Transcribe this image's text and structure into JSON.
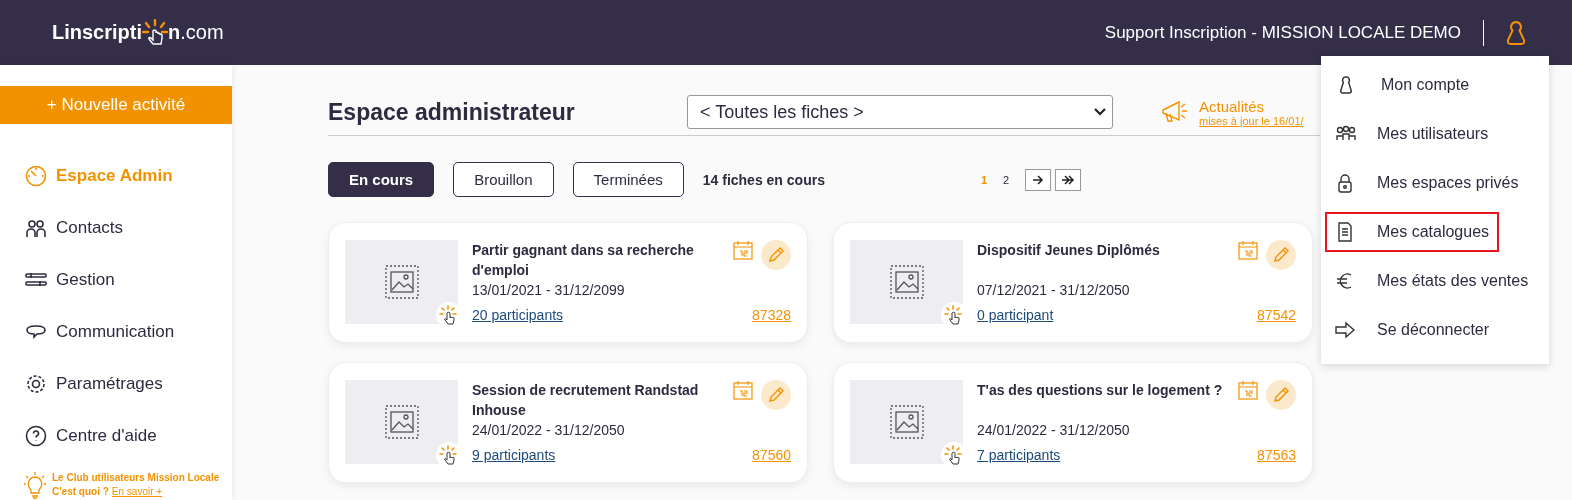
{
  "header": {
    "logo": {
      "start": "Linscripti",
      "end": "n",
      ".com": ".com"
    },
    "account": "Support Inscription - MISSION LOCALE DEMO"
  },
  "sidebar": {
    "new_button": "+ Nouvelle activité",
    "items": [
      {
        "label": "Espace Admin",
        "selected": true
      },
      {
        "label": "Contacts",
        "selected": false
      },
      {
        "label": "Gestion",
        "selected": false
      },
      {
        "label": "Communication",
        "selected": false
      },
      {
        "label": "Paramétrages",
        "selected": false
      },
      {
        "label": "Centre d'aide",
        "selected": false
      }
    ],
    "club": {
      "title": "Le Club utilisateurs Mission Locale",
      "question": "C'est quoi ?",
      "link": "En savoir +"
    }
  },
  "main": {
    "title": "Espace administrateur",
    "filter": "< Toutes les fiches >",
    "news": {
      "title": "Actualités",
      "subtitle": "mises à jour le 16/01/"
    },
    "tabs": [
      {
        "label": "En cours",
        "selected": true
      },
      {
        "label": "Brouillon",
        "selected": false
      },
      {
        "label": "Terminées",
        "selected": false
      }
    ],
    "count": "14 fiches en cours",
    "pages": [
      {
        "label": "1",
        "selected": true
      },
      {
        "label": "2",
        "selected": false
      }
    ],
    "cards": [
      {
        "title": "Partir gagnant dans sa recherche d'emploi",
        "dates": "13/01/2021 - 31/12/2099",
        "participants": "20 participants",
        "id": "87328"
      },
      {
        "title": "Dispositif Jeunes Diplômés",
        "dates": "07/12/2021 - 31/12/2050",
        "participants": "0 participant",
        "id": "87542"
      },
      {
        "title": "Session de recrutement Randstad Inhouse",
        "dates": "24/01/2022 - 31/12/2050",
        "participants": "9 participants",
        "id": "87560"
      },
      {
        "title": "T'as des questions sur le logement ?",
        "dates": "24/01/2022 - 31/12/2050",
        "participants": "7 participants",
        "id": "87563"
      }
    ]
  },
  "user_menu": {
    "items": [
      {
        "label": "Mon compte",
        "highlighted": false
      },
      {
        "label": "Mes utilisateurs",
        "highlighted": false
      },
      {
        "label": "Mes espaces privés",
        "highlighted": false
      },
      {
        "label": "Mes catalogues",
        "highlighted": true
      },
      {
        "label": "Mes états des ventes",
        "highlighted": false
      },
      {
        "label": "Se déconnecter",
        "highlighted": false
      }
    ]
  }
}
